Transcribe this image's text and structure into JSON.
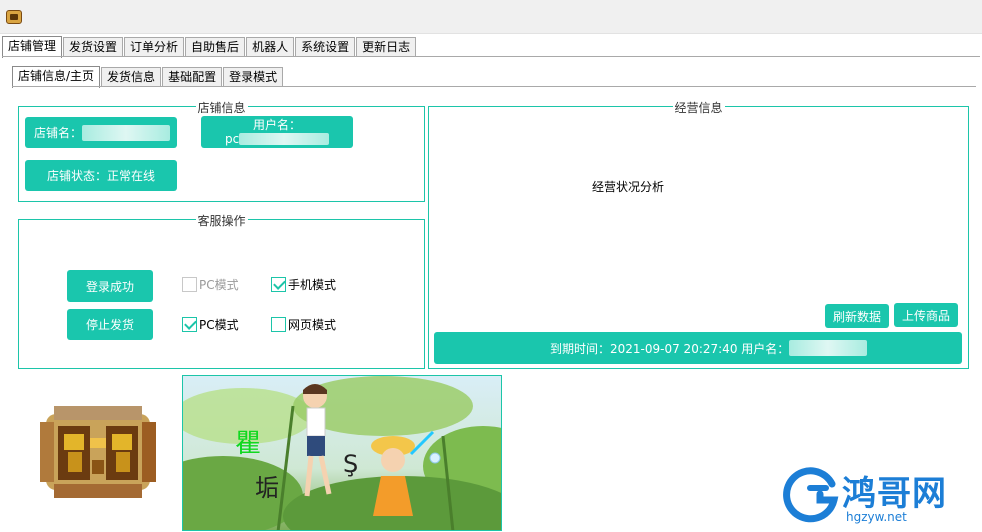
{
  "main_tabs": [
    "店铺管理",
    "发货设置",
    "订单分析",
    "自助售后",
    "机器人",
    "系统设置",
    "更新日志"
  ],
  "sub_tabs": [
    "店铺信息/主页",
    "发货信息",
    "基础配置",
    "登录模式"
  ],
  "shop_info": {
    "title": "店铺信息",
    "shop_name_label": "店铺名：",
    "username_label": "用户名：",
    "username_prefix": "pc",
    "status_label": "店铺状态：正常在线"
  },
  "service_ops": {
    "title": "客服操作",
    "login_button": "登录成功",
    "stop_button": "停止发货",
    "pc_mode_disabled": "PC模式",
    "mobile_mode": "手机模式",
    "pc_mode": "PC模式",
    "web_mode": "网页模式"
  },
  "business": {
    "title": "经营信息",
    "analysis_label": "经营状况分析",
    "refresh_button": "刷新数据",
    "upload_button": "上传商品",
    "expiry_text": "到期时间：2021-09-07 20:27:40  用户名："
  },
  "illustration_text": [
    "瞿",
    "垢",
    "Ş"
  ],
  "watermark": {
    "title": "鸿哥网",
    "url": "hgzyw.net",
    "color": "#1c7ed6"
  },
  "colors": {
    "accent": "#1ac6ad",
    "border": "#1cc5a9"
  }
}
